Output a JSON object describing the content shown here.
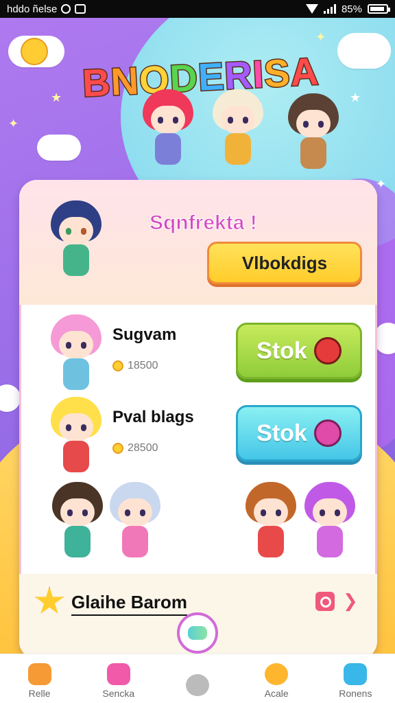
{
  "status_bar": {
    "left_text": "hddo ñelse",
    "battery": "85%"
  },
  "header": {
    "logo_text": "BNODERISA",
    "logo_colors": [
      "#ff4b4b",
      "#ff9a2a",
      "#ffd23a",
      "#59d44e",
      "#3fb0ff",
      "#a45bff",
      "#ff4ba8",
      "#ffb02a",
      "#ff4b4b"
    ]
  },
  "card": {
    "greeting": "Sqnfrekta !",
    "head_button": "Vlbokdigs",
    "rows": [
      {
        "name": "Sugvam",
        "meta": "18500",
        "button": "Stok"
      },
      {
        "name": "Pval blags",
        "meta": "28500",
        "button": "Stok"
      }
    ],
    "section_title": "Glaihe Barom"
  },
  "tabbar": {
    "tabs": [
      {
        "label": "Relle",
        "icon": "home-icon",
        "color": "#f59a35"
      },
      {
        "label": "Sencka",
        "icon": "flower-icon",
        "color": "#f05aa8"
      },
      {
        "label": "",
        "icon": "menu-icon",
        "color": "#bbbbbb"
      },
      {
        "label": "Acale",
        "icon": "smiley-icon",
        "color": "#ffb52e"
      },
      {
        "label": "Ronens",
        "icon": "cloud-icon",
        "color": "#39b7e8"
      }
    ]
  }
}
